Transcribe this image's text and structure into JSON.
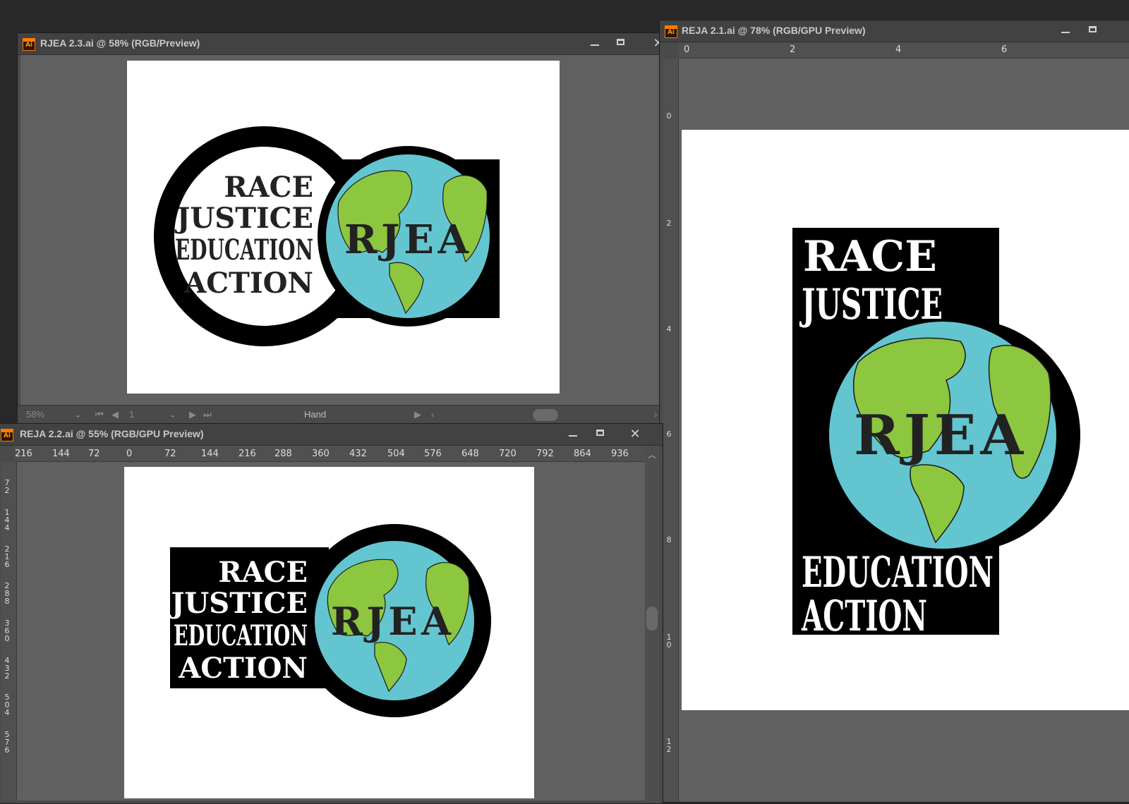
{
  "windows": [
    {
      "id": "rjea-2-3",
      "title": "RJEA 2.3.ai @ 58% (RGB/Preview)",
      "app_icon": "ai-icon",
      "app_icon_label": "Ai",
      "zoom": "58%",
      "page": "1",
      "tool": "Hand",
      "logo": {
        "line1": "RACE",
        "line2": "JUSTICE",
        "line3": "EDUCATION",
        "line4": "ACTION",
        "initials": "RJEA"
      }
    },
    {
      "id": "reja-2-1",
      "title": "REJA 2.1.ai @ 78% (RGB/GPU Preview)",
      "app_icon": "ai-icon",
      "app_icon_label": "Ai",
      "hruler": [
        "0",
        "2",
        "4",
        "6"
      ],
      "vruler": [
        "0",
        "2",
        "4",
        "6",
        "8",
        "1\n0",
        "1\n2"
      ],
      "logo": {
        "line1": "RACE",
        "line2": "JUSTICE",
        "line3": "EDUCATION",
        "line4": "ACTION",
        "initials": "RJEA"
      }
    },
    {
      "id": "reja-2-2",
      "title": "REJA 2.2.ai @ 55% (RGB/GPU Preview)",
      "app_icon": "ai-icon",
      "app_icon_label": "Ai",
      "hruler": [
        "216",
        "144",
        "72",
        "0",
        "72",
        "144",
        "216",
        "288",
        "360",
        "432",
        "504",
        "576",
        "648",
        "720",
        "792",
        "864",
        "936"
      ],
      "vruler": [
        "7\n2",
        "1\n4\n4",
        "2\n1\n6",
        "2\n8\n8",
        "3\n6\n0",
        "4\n3\n2",
        "5\n0\n4",
        "5\n7\n6"
      ],
      "logo": {
        "line1": "RACE",
        "line2": "JUSTICE",
        "line3": "EDUCATION",
        "line4": "ACTION",
        "initials": "RJEA"
      }
    }
  ],
  "colors": {
    "ocean": "#63c5d0",
    "land": "#8dc63f",
    "ink": "#000000",
    "logo_text": "#222222"
  }
}
